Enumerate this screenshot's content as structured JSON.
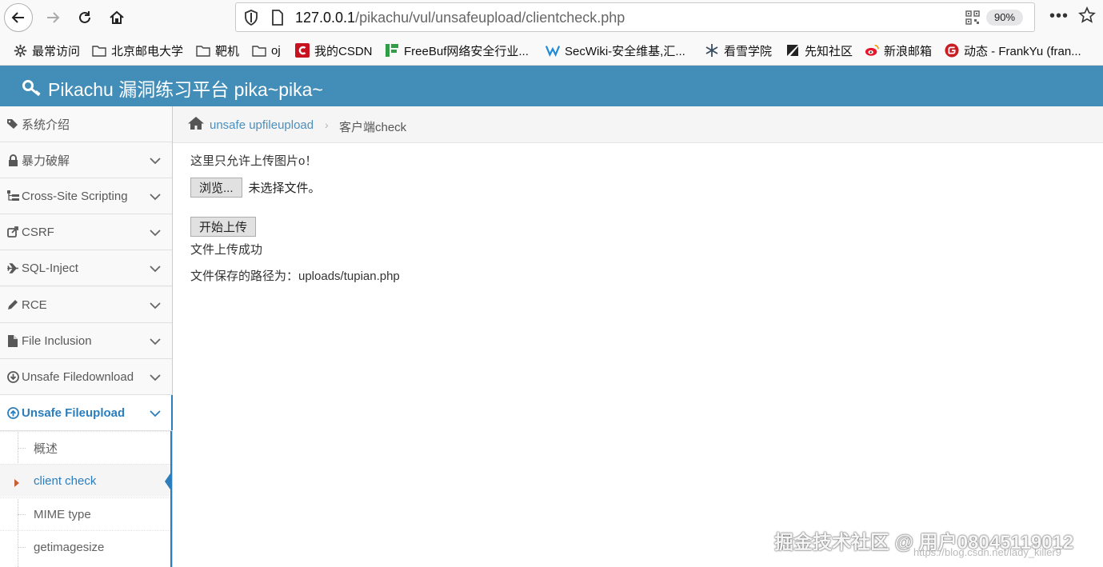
{
  "browser": {
    "url_host": "127.0.0.1",
    "url_path": "/pikachu/vul/unsafeupload/clientcheck.php",
    "zoom": "90%",
    "menu_label": "•••"
  },
  "bookmarks": [
    {
      "label": "最常访问",
      "icon": "gear-icon"
    },
    {
      "label": "北京邮电大学",
      "icon": "folder-icon"
    },
    {
      "label": "靶机",
      "icon": "folder-icon"
    },
    {
      "label": "oj",
      "icon": "folder-icon"
    },
    {
      "label": "我的CSDN",
      "icon": "csdn-icon"
    },
    {
      "label": "FreeBuf网络安全行业...",
      "icon": "freebuf-icon"
    },
    {
      "label": "SecWiki-安全维基,汇...",
      "icon": "secwiki-icon"
    },
    {
      "label": "看雪学院",
      "icon": "snowflake-icon"
    },
    {
      "label": "先知社区",
      "icon": "xianzhi-icon"
    },
    {
      "label": "新浪邮箱",
      "icon": "weibo-icon"
    },
    {
      "label": "动态 - FrankYu (fran...",
      "icon": "gitee-icon"
    }
  ],
  "header": {
    "title": "Pikachu 漏洞练习平台 pika~pika~"
  },
  "sidebar": {
    "items": [
      {
        "label": "系统介绍",
        "icon": "tags-icon"
      },
      {
        "label": "暴力破解",
        "icon": "lock-icon"
      },
      {
        "label": "Cross-Site Scripting",
        "icon": "sitemap-icon"
      },
      {
        "label": "CSRF",
        "icon": "share-icon"
      },
      {
        "label": "SQL-Inject",
        "icon": "plane-icon"
      },
      {
        "label": "RCE",
        "icon": "pencil-icon"
      },
      {
        "label": "File Inclusion",
        "icon": "file-icon"
      },
      {
        "label": "Unsafe Filedownload",
        "icon": "download-icon"
      },
      {
        "label": "Unsafe Fileupload",
        "icon": "upload-icon"
      }
    ],
    "subitems": [
      {
        "label": "概述"
      },
      {
        "label": "client check"
      },
      {
        "label": "MIME type"
      },
      {
        "label": "getimagesize"
      }
    ]
  },
  "breadcrumb": {
    "parent": "unsafe upfileupload",
    "separator": "›",
    "current": "客户端check"
  },
  "main": {
    "notice": "这里只允许上传图片o！",
    "browse_label": "浏览...",
    "no_file": "未选择文件。",
    "upload_label": "开始上传",
    "success": "文件上传成功",
    "path": "文件保存的路径为：uploads/tupian.php"
  },
  "watermark": {
    "text": "掘金技术社区 @ 用户08045119012",
    "url": "https://blog.csdn.net/lady_killer9"
  },
  "colors": {
    "header": "#438eb9",
    "accent": "#2b7dbc",
    "link": "#4c8fbd"
  }
}
